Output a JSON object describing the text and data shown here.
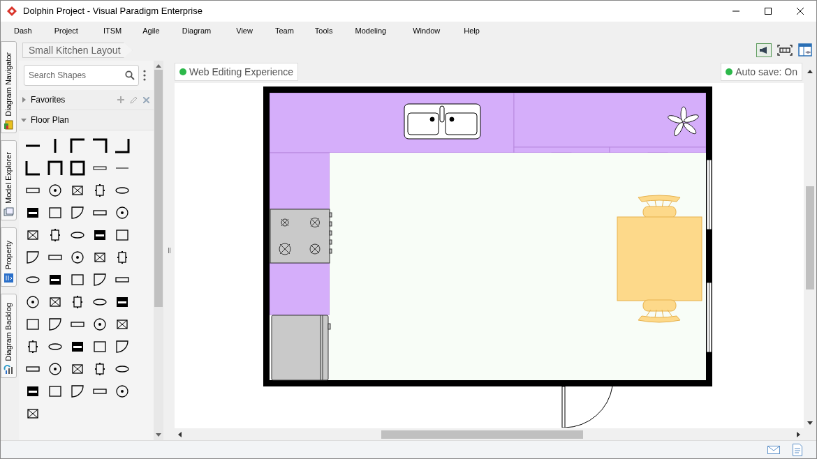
{
  "window": {
    "title": "Dolphin Project - Visual Paradigm Enterprise"
  },
  "menu": [
    "Dash",
    "Project",
    "ITSM",
    "Agile",
    "Diagram",
    "View",
    "Team",
    "Tools",
    "Modeling",
    "Window",
    "Help"
  ],
  "side_tabs": [
    "Diagram Navigator",
    "Model Explorer",
    "Property",
    "Diagram Backlog"
  ],
  "breadcrumb": "Small Kitchen Layout",
  "shapes_panel": {
    "search": {
      "placeholder": "Search Shapes"
    },
    "groups": [
      {
        "label": "Favorites",
        "expanded": false
      },
      {
        "label": "Floor Plan",
        "expanded": true
      }
    ]
  },
  "canvas": {
    "web_editing": "Web Editing Experience",
    "auto_save": "Auto save: On"
  }
}
